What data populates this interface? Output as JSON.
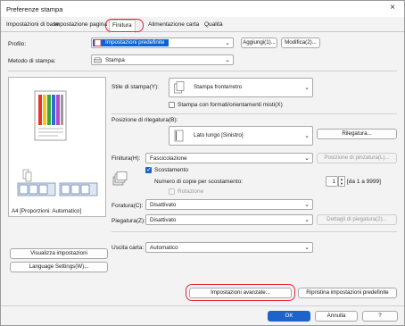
{
  "window": {
    "title": "Preferenze stampa",
    "close_icon": "×"
  },
  "tabs": [
    {
      "label": "Impostazioni di base"
    },
    {
      "label": "Impostazione pagina"
    },
    {
      "label": "Finitura"
    },
    {
      "label": "Alimentazione carta"
    },
    {
      "label": "Qualità"
    }
  ],
  "profile": {
    "label": "Profilo:",
    "value": "Impostazioni predefinite",
    "add_label": "Aggiungi(1)...",
    "edit_label": "Modifica(2)..."
  },
  "print_method": {
    "label": "Metodo di stampa:",
    "value": "Stampa"
  },
  "preview": {
    "caption": "A4 [Proporzioni: Automatico]"
  },
  "left_buttons": {
    "view_settings": "Visualizza impostazioni",
    "language_settings": "Language Settings(W)..."
  },
  "print_style": {
    "label": "Stile di stampa(Y):",
    "value": "Stampa fronte/retro",
    "mixed_label": "Stampa con formati/orientamenti misti(X)"
  },
  "binding": {
    "label": "Posizione di rilegatura(B):",
    "value": "Lato lungo [Sinistro]",
    "button": "Rilegatura..."
  },
  "finishing": {
    "label": "Finitura(H):",
    "value": "Fascicolazione",
    "stapling_button": "Posizione di pinzatura(L)...",
    "offset_label": "Scostamento",
    "copies_label": "Numero di copie per scostamento:",
    "copies_value": "1",
    "copies_range": "[da 1 a 9999]",
    "rotation_label": "Rotazione"
  },
  "punching": {
    "label": "Foratura(C):",
    "value": "Disattivato"
  },
  "folding": {
    "label": "Piegatura(Z):",
    "value": "Disattivato",
    "button": "Dettagli di piegatura(2)..."
  },
  "output": {
    "label": "Uscita carta:",
    "value": "Automatico"
  },
  "footer": {
    "advanced": "Impostazioni avanzate...",
    "restore": "Ripristina impostazioni predefinite",
    "ok": "OK",
    "cancel": "Annulla",
    "help": "?"
  },
  "colors": {
    "accent": "#1d63c9",
    "highlight": "#e0283a"
  }
}
